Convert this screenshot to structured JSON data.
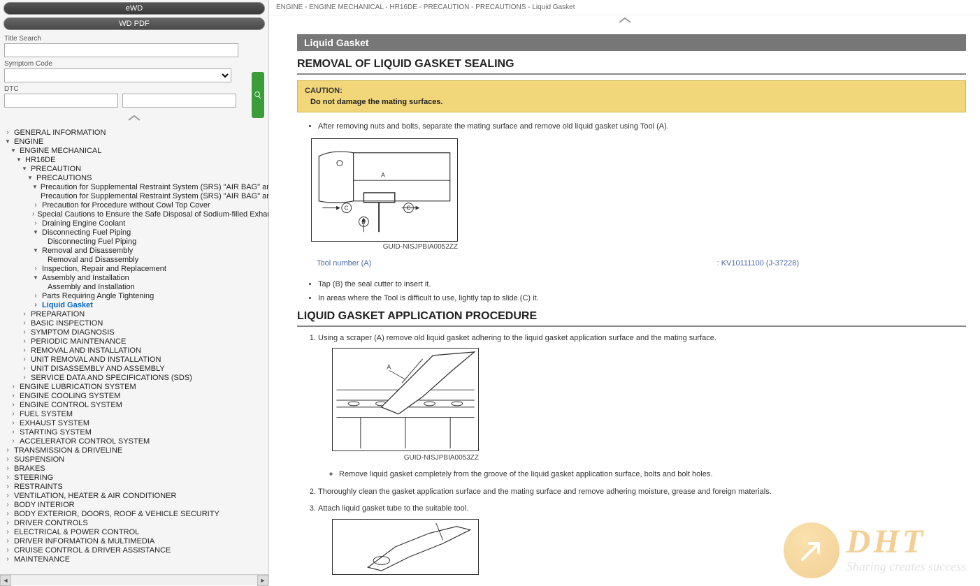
{
  "tabs": {
    "ewd": "eWD",
    "wdpdf": "WD PDF"
  },
  "search": {
    "title_label": "Title Search",
    "symptom_label": "Symptom Code",
    "dtc_label": "DTC"
  },
  "tree": [
    {
      "l": 0,
      "a": ">",
      "t": "GENERAL INFORMATION"
    },
    {
      "l": 0,
      "a": "▼",
      "t": "ENGINE"
    },
    {
      "l": 1,
      "a": "▼",
      "t": "ENGINE MECHANICAL"
    },
    {
      "l": 2,
      "a": "▼",
      "t": "HR16DE"
    },
    {
      "l": 3,
      "a": "▼",
      "t": "PRECAUTION"
    },
    {
      "l": 4,
      "a": "▼",
      "t": "PRECAUTIONS"
    },
    {
      "l": 5,
      "a": "▼",
      "t": "Precaution for Supplemental Restraint System (SRS) \"AIR BAG\" and \"SE…"
    },
    {
      "l": 6,
      "a": "",
      "t": "Precaution for Supplemental Restraint System (SRS) \"AIR BAG\" and \"SE…"
    },
    {
      "l": 5,
      "a": ">",
      "t": "Precaution for Procedure without Cowl Top Cover"
    },
    {
      "l": 5,
      "a": ">",
      "t": "Special Cautions to Ensure the Safe Disposal of Sodium-filled Exhaust V…"
    },
    {
      "l": 5,
      "a": ">",
      "t": "Draining Engine Coolant"
    },
    {
      "l": 5,
      "a": "▼",
      "t": "Disconnecting Fuel Piping"
    },
    {
      "l": 6,
      "a": "",
      "t": "Disconnecting Fuel Piping"
    },
    {
      "l": 5,
      "a": "▼",
      "t": "Removal and Disassembly"
    },
    {
      "l": 6,
      "a": "",
      "t": "Removal and Disassembly"
    },
    {
      "l": 5,
      "a": ">",
      "t": "Inspection, Repair and Replacement"
    },
    {
      "l": 5,
      "a": "▼",
      "t": "Assembly and Installation"
    },
    {
      "l": 6,
      "a": "",
      "t": "Assembly and Installation"
    },
    {
      "l": 5,
      "a": ">",
      "t": "Parts Requiring Angle Tightening"
    },
    {
      "l": 5,
      "a": ">",
      "t": "Liquid Gasket",
      "sel": true
    },
    {
      "l": 3,
      "a": ">",
      "t": "PREPARATION"
    },
    {
      "l": 3,
      "a": ">",
      "t": "BASIC INSPECTION"
    },
    {
      "l": 3,
      "a": ">",
      "t": "SYMPTOM DIAGNOSIS"
    },
    {
      "l": 3,
      "a": ">",
      "t": "PERIODIC MAINTENANCE"
    },
    {
      "l": 3,
      "a": ">",
      "t": "REMOVAL AND INSTALLATION"
    },
    {
      "l": 3,
      "a": ">",
      "t": "UNIT REMOVAL AND INSTALLATION"
    },
    {
      "l": 3,
      "a": ">",
      "t": "UNIT DISASSEMBLY AND ASSEMBLY"
    },
    {
      "l": 3,
      "a": ">",
      "t": "SERVICE DATA AND SPECIFICATIONS (SDS)"
    },
    {
      "l": 1,
      "a": ">",
      "t": "ENGINE LUBRICATION SYSTEM"
    },
    {
      "l": 1,
      "a": ">",
      "t": "ENGINE COOLING SYSTEM"
    },
    {
      "l": 1,
      "a": ">",
      "t": "ENGINE CONTROL SYSTEM"
    },
    {
      "l": 1,
      "a": ">",
      "t": "FUEL SYSTEM"
    },
    {
      "l": 1,
      "a": ">",
      "t": "EXHAUST SYSTEM"
    },
    {
      "l": 1,
      "a": ">",
      "t": "STARTING SYSTEM"
    },
    {
      "l": 1,
      "a": ">",
      "t": "ACCELERATOR CONTROL SYSTEM"
    },
    {
      "l": 0,
      "a": ">",
      "t": "TRANSMISSION & DRIVELINE"
    },
    {
      "l": 0,
      "a": ">",
      "t": "SUSPENSION"
    },
    {
      "l": 0,
      "a": ">",
      "t": "BRAKES"
    },
    {
      "l": 0,
      "a": ">",
      "t": "STEERING"
    },
    {
      "l": 0,
      "a": ">",
      "t": "RESTRAINTS"
    },
    {
      "l": 0,
      "a": ">",
      "t": "VENTILATION, HEATER & AIR CONDITIONER"
    },
    {
      "l": 0,
      "a": ">",
      "t": "BODY INTERIOR"
    },
    {
      "l": 0,
      "a": ">",
      "t": "BODY EXTERIOR, DOORS, ROOF & VEHICLE SECURITY"
    },
    {
      "l": 0,
      "a": ">",
      "t": "DRIVER CONTROLS"
    },
    {
      "l": 0,
      "a": ">",
      "t": "ELECTRICAL & POWER CONTROL"
    },
    {
      "l": 0,
      "a": ">",
      "t": "DRIVER INFORMATION & MULTIMEDIA"
    },
    {
      "l": 0,
      "a": ">",
      "t": "CRUISE CONTROL & DRIVER ASSISTANCE"
    },
    {
      "l": 0,
      "a": ">",
      "t": "MAINTENANCE"
    }
  ],
  "breadcrumb": "ENGINE - ENGINE MECHANICAL - HR16DE - PRECAUTION - PRECAUTIONS - Liquid Gasket",
  "page": {
    "title": "Liquid Gasket",
    "h1": "REMOVAL OF LIQUID GASKET SEALING",
    "caution_label": "CAUTION:",
    "caution_text": "Do not damage the mating surfaces.",
    "b1": "After removing nuts and bolts, separate the mating surface and remove old liquid gasket using Tool (A).",
    "fig1_caption": "GUID-NISJPBIA0052ZZ",
    "tool_label": "Tool number (A)",
    "tool_value": ": KV10111100 (J-37228)",
    "b2": "Tap (B) the seal cutter to insert it.",
    "b3": "In areas where the Tool is difficult to use, lightly tap to slide (C) it.",
    "h2": "LIQUID GASKET APPLICATION PROCEDURE",
    "o1": "Using a scraper (A) remove old liquid gasket adhering to the liquid gasket application surface and the mating surface.",
    "fig2_caption": "GUID-NISJPBIA0053ZZ",
    "o1_sub": "Remove liquid gasket completely from the groove of the liquid gasket application surface, bolts and bolt holes.",
    "o2": "Thoroughly clean the gasket application surface and the mating surface and remove adhering moisture, grease and foreign materials.",
    "o3": "Attach liquid gasket tube to the suitable tool."
  },
  "watermark": {
    "main": "DHT",
    "sub": "Sharing creates success"
  }
}
